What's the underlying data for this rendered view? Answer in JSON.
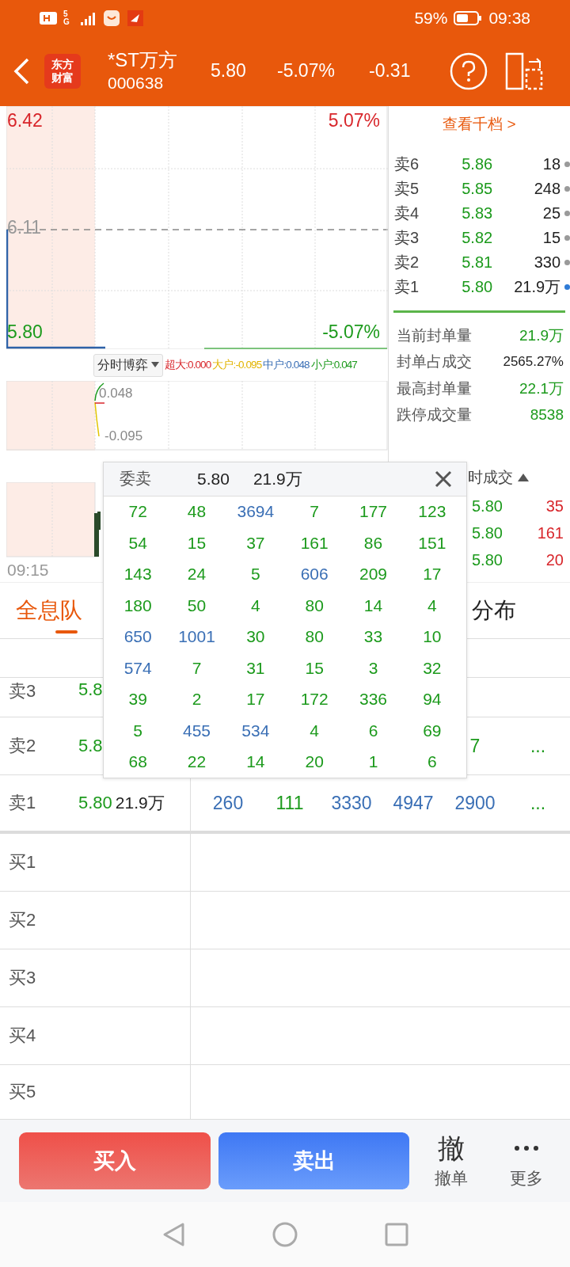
{
  "status_bar": {
    "network": "5G",
    "battery": "59%",
    "time": "09:38"
  },
  "header": {
    "logo": [
      "东方",
      "财富"
    ],
    "name": "*ST万方",
    "code": "000638",
    "price": "5.80",
    "change_pct": "-5.07%",
    "change": "-0.31"
  },
  "chart": {
    "high": "6.42",
    "high_pct": "5.07%",
    "prev_close": "6.11",
    "low": "5.80",
    "low_pct": "-5.07%",
    "indicator": {
      "label": "分时博弈",
      "values": [
        {
          "text": "超大:0.000",
          "color": "#d8262b"
        },
        {
          "text": "大户:-0.095",
          "color": "#e2b400"
        },
        {
          "text": "中户:0.048",
          "color": "#3a6fb5"
        },
        {
          "text": "小户:0.047",
          "color": "#1c9a1c"
        }
      ]
    },
    "indicator_high": "0.048",
    "indicator_low": "-0.095",
    "time_start": "09:15"
  },
  "order_book": {
    "link": "查看千档 >",
    "asks": [
      {
        "label": "卖6",
        "price": "5.86",
        "volume": "18",
        "color": "#9a9a9a"
      },
      {
        "label": "卖5",
        "price": "5.85",
        "volume": "248",
        "color": "#9a9a9a"
      },
      {
        "label": "卖4",
        "price": "5.83",
        "volume": "25",
        "color": "#9a9a9a"
      },
      {
        "label": "卖3",
        "price": "5.82",
        "volume": "15",
        "color": "#9a9a9a"
      },
      {
        "label": "卖2",
        "price": "5.81",
        "volume": "330",
        "color": "#9a9a9a"
      },
      {
        "label": "卖1",
        "price": "5.80",
        "volume": "21.9万",
        "color": "#2f7bd6"
      }
    ],
    "stats": [
      {
        "label": "当前封单量",
        "value": "21.9万",
        "color": "#1c9a1c"
      },
      {
        "label": "封单占成交",
        "value": "2565.27%",
        "color": "#222222"
      },
      {
        "label": "最高封单量",
        "value": "22.1万",
        "color": "#1c9a1c"
      },
      {
        "label": "跌停成交量",
        "value": "8538",
        "color": "#1c9a1c"
      }
    ]
  },
  "trades": {
    "title": "时成交",
    "rows": [
      {
        "price": "5.80",
        "volume": "35"
      },
      {
        "price": "5.80",
        "volume": "161"
      },
      {
        "price": "5.80",
        "volume": "20"
      }
    ]
  },
  "tabs": [
    {
      "label": "全息队",
      "selected": true
    },
    {
      "label": "分布",
      "selected": false
    }
  ],
  "queue": {
    "asks": [
      {
        "label": "卖3",
        "price": "5.8"
      },
      {
        "label": "卖2",
        "price": "5.8",
        "orders": [
          {
            "text": "7",
            "color": "#1c9a1c"
          }
        ],
        "more": "..."
      },
      {
        "label": "卖1",
        "price": "5.80",
        "volume": "21.9万",
        "orders": [
          {
            "text": "260",
            "color": "#3a6fb5"
          },
          {
            "text": "111",
            "color": "#1c9a1c"
          },
          {
            "text": "3330",
            "color": "#3a6fb5"
          },
          {
            "text": "4947",
            "color": "#3a6fb5"
          },
          {
            "text": "2900",
            "color": "#3a6fb5"
          }
        ],
        "more": "..."
      }
    ],
    "bids": [
      {
        "label": "买1"
      },
      {
        "label": "买2"
      },
      {
        "label": "买3"
      },
      {
        "label": "买4"
      },
      {
        "label": "买5"
      }
    ]
  },
  "popup": {
    "title": "委卖",
    "price": "5.80",
    "volume": "21.9万",
    "cells": [
      [
        {
          "text": "72",
          "color": "#1c9a1c"
        },
        {
          "text": "48",
          "color": "#1c9a1c"
        },
        {
          "text": "3694",
          "color": "#3a6fb5"
        },
        {
          "text": "7",
          "color": "#1c9a1c"
        },
        {
          "text": "177",
          "color": "#1c9a1c"
        },
        {
          "text": "123",
          "color": "#1c9a1c"
        }
      ],
      [
        {
          "text": "54",
          "color": "#1c9a1c"
        },
        {
          "text": "15",
          "color": "#1c9a1c"
        },
        {
          "text": "37",
          "color": "#1c9a1c"
        },
        {
          "text": "161",
          "color": "#1c9a1c"
        },
        {
          "text": "86",
          "color": "#1c9a1c"
        },
        {
          "text": "151",
          "color": "#1c9a1c"
        }
      ],
      [
        {
          "text": "143",
          "color": "#1c9a1c"
        },
        {
          "text": "24",
          "color": "#1c9a1c"
        },
        {
          "text": "5",
          "color": "#1c9a1c"
        },
        {
          "text": "606",
          "color": "#3a6fb5"
        },
        {
          "text": "209",
          "color": "#1c9a1c"
        },
        {
          "text": "17",
          "color": "#1c9a1c"
        }
      ],
      [
        {
          "text": "180",
          "color": "#1c9a1c"
        },
        {
          "text": "50",
          "color": "#1c9a1c"
        },
        {
          "text": "4",
          "color": "#1c9a1c"
        },
        {
          "text": "80",
          "color": "#1c9a1c"
        },
        {
          "text": "14",
          "color": "#1c9a1c"
        },
        {
          "text": "4",
          "color": "#1c9a1c"
        }
      ],
      [
        {
          "text": "650",
          "color": "#3a6fb5"
        },
        {
          "text": "1001",
          "color": "#3a6fb5"
        },
        {
          "text": "30",
          "color": "#1c9a1c"
        },
        {
          "text": "80",
          "color": "#1c9a1c"
        },
        {
          "text": "33",
          "color": "#1c9a1c"
        },
        {
          "text": "10",
          "color": "#1c9a1c"
        }
      ],
      [
        {
          "text": "574",
          "color": "#3a6fb5"
        },
        {
          "text": "7",
          "color": "#1c9a1c"
        },
        {
          "text": "31",
          "color": "#1c9a1c"
        },
        {
          "text": "15",
          "color": "#1c9a1c"
        },
        {
          "text": "3",
          "color": "#1c9a1c"
        },
        {
          "text": "32",
          "color": "#1c9a1c"
        }
      ],
      [
        {
          "text": "39",
          "color": "#1c9a1c"
        },
        {
          "text": "2",
          "color": "#1c9a1c"
        },
        {
          "text": "17",
          "color": "#1c9a1c"
        },
        {
          "text": "172",
          "color": "#1c9a1c"
        },
        {
          "text": "336",
          "color": "#1c9a1c"
        },
        {
          "text": "94",
          "color": "#1c9a1c"
        }
      ],
      [
        {
          "text": "5",
          "color": "#1c9a1c"
        },
        {
          "text": "455",
          "color": "#3a6fb5"
        },
        {
          "text": "534",
          "color": "#3a6fb5"
        },
        {
          "text": "4",
          "color": "#1c9a1c"
        },
        {
          "text": "6",
          "color": "#1c9a1c"
        },
        {
          "text": "69",
          "color": "#1c9a1c"
        }
      ],
      [
        {
          "text": "68",
          "color": "#1c9a1c"
        },
        {
          "text": "22",
          "color": "#1c9a1c"
        },
        {
          "text": "14",
          "color": "#1c9a1c"
        },
        {
          "text": "20",
          "color": "#1c9a1c"
        },
        {
          "text": "1",
          "color": "#1c9a1c"
        },
        {
          "text": "6",
          "color": "#1c9a1c"
        }
      ]
    ]
  },
  "actions": {
    "buy": "买入",
    "sell": "卖出",
    "cancel_icon": "撤",
    "cancel": "撤单",
    "more": "更多"
  }
}
